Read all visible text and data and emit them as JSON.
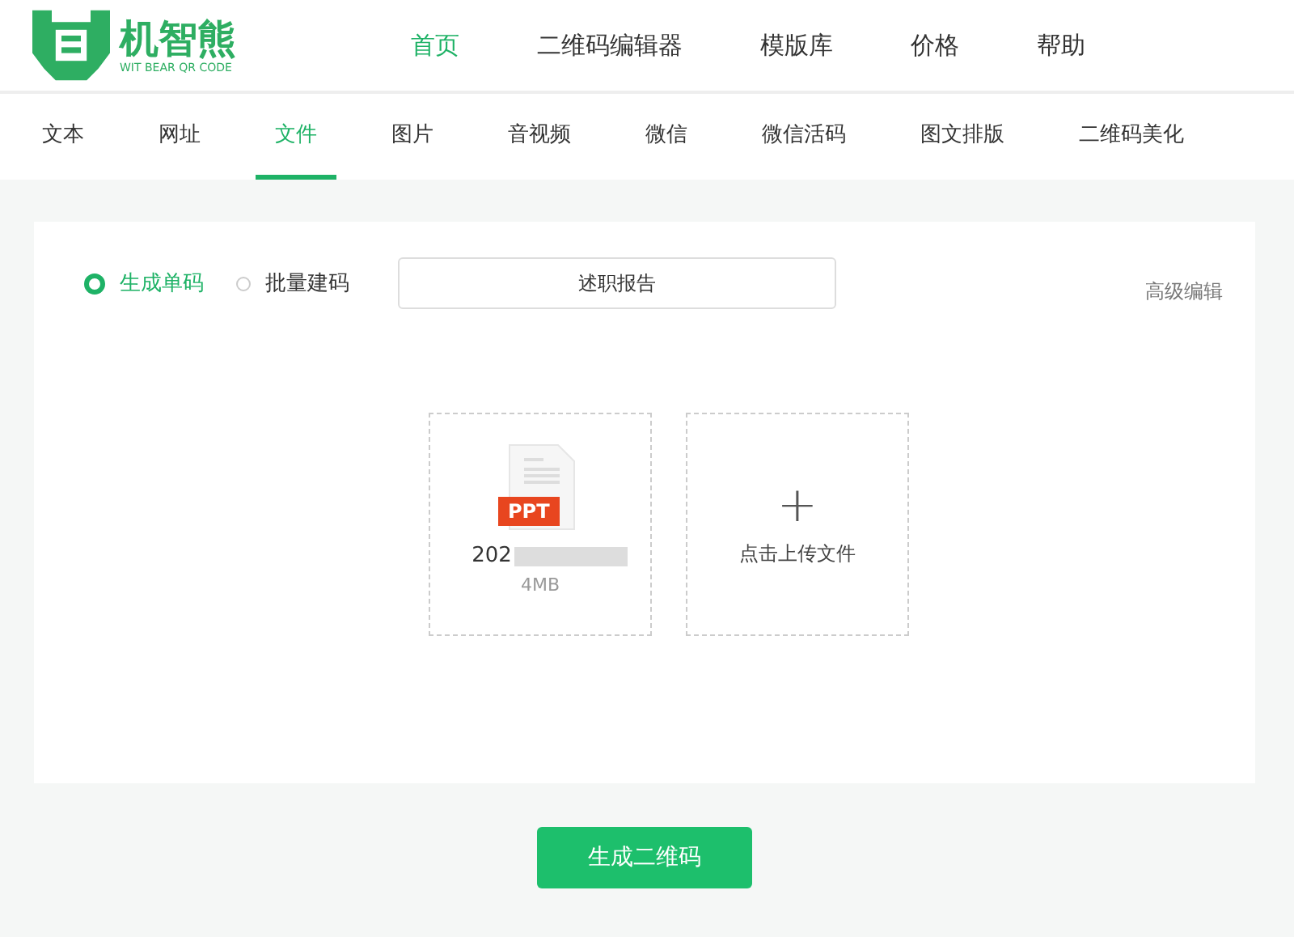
{
  "logo": {
    "name": "机智熊",
    "tagline": "WIT BEAR QR CODE"
  },
  "nav": [
    {
      "label": "首页",
      "selected": true
    },
    {
      "label": "二维码编辑器",
      "selected": false
    },
    {
      "label": "模版库",
      "selected": false
    },
    {
      "label": "价格",
      "selected": false
    },
    {
      "label": "帮助",
      "selected": false
    }
  ],
  "tabs": [
    {
      "label": "文本",
      "selected": false
    },
    {
      "label": "网址",
      "selected": false
    },
    {
      "label": "文件",
      "selected": true
    },
    {
      "label": "图片",
      "selected": false
    },
    {
      "label": "音视频",
      "selected": false
    },
    {
      "label": "微信",
      "selected": false
    },
    {
      "label": "微信活码",
      "selected": false
    },
    {
      "label": "图文排版",
      "selected": false
    },
    {
      "label": "二维码美化",
      "selected": false
    }
  ],
  "modes": [
    {
      "label": "生成单码",
      "selected": true
    },
    {
      "label": "批量建码",
      "selected": false
    }
  ],
  "title_field": {
    "value": "述职报告"
  },
  "advanced_link": "高级编辑",
  "file": {
    "badge": "PPT",
    "name": "202",
    "size": "4MB"
  },
  "upload": {
    "icon": "+",
    "label": "点击上传文件"
  },
  "generate_button": "生成二维码"
}
